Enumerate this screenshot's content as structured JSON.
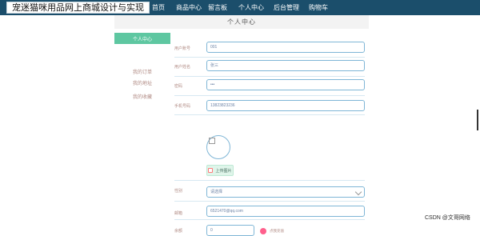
{
  "app": {
    "title": "宠迷猫咪用品网上商城设计与实现",
    "nav": {
      "items": [
        "首页",
        "商品中心",
        "留言板",
        "个人中心",
        "后台管理",
        "购物车"
      ]
    }
  },
  "page": {
    "header_title": "个人中心"
  },
  "sidebar": {
    "items": [
      {
        "label": "个人中心",
        "active": true
      },
      {
        "label": "我的订单",
        "active": false
      },
      {
        "label": "我的地址",
        "active": false
      },
      {
        "label": "我的收藏",
        "active": false
      }
    ]
  },
  "form": {
    "labels": {
      "user_account": "用户账号",
      "user_name": "用户姓名",
      "password": "密码",
      "phone": "手机号码",
      "gender": "性别",
      "email": "邮箱",
      "balance": "余额"
    },
    "values": {
      "user_account": "001",
      "user_name": "张三",
      "password": "•••",
      "phone": "13823823236",
      "email": "6521470@qq.com",
      "balance": "0"
    },
    "placeholders": {
      "gender": "请选择"
    },
    "upload_label": "上传图片",
    "recharge_label": "点我充值"
  },
  "watermark": "CSDN @文哥网络"
}
